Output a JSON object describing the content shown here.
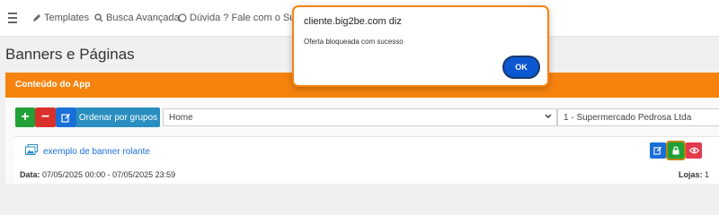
{
  "topbar": {
    "nav": [
      {
        "label": "Templates",
        "icon": "pen-icon"
      },
      {
        "label": "Busca Avançada",
        "icon": "search-icon"
      },
      {
        "label": "Dúvida ? Fale com o Suporte",
        "icon": "whatsapp-icon"
      }
    ]
  },
  "page": {
    "title": "Banners e Páginas"
  },
  "card": {
    "header": "Conteúdo do App"
  },
  "toolbar": {
    "add_label": "+",
    "remove_label": "−",
    "group_label": "Ordenar por grupos",
    "page_select_value": "Home",
    "store_select_value": "1 - Supermercado Pedrosa Ltda"
  },
  "banner": {
    "link": "exemplo de banner rolante",
    "date_label": "Data:",
    "date_value": " 07/05/2025 00:00 - 07/05/2025 23:59",
    "stores_label": "Lojas:",
    "stores_value": " 1"
  },
  "dialog": {
    "title": "cliente.big2be.com diz",
    "message": "Oferta bloqueada com sucesso",
    "ok_label": "OK"
  },
  "colors": {
    "brand_orange": "#f7830f",
    "success": "#21a038",
    "danger": "#d9302c",
    "primary": "#1a6fd8"
  }
}
